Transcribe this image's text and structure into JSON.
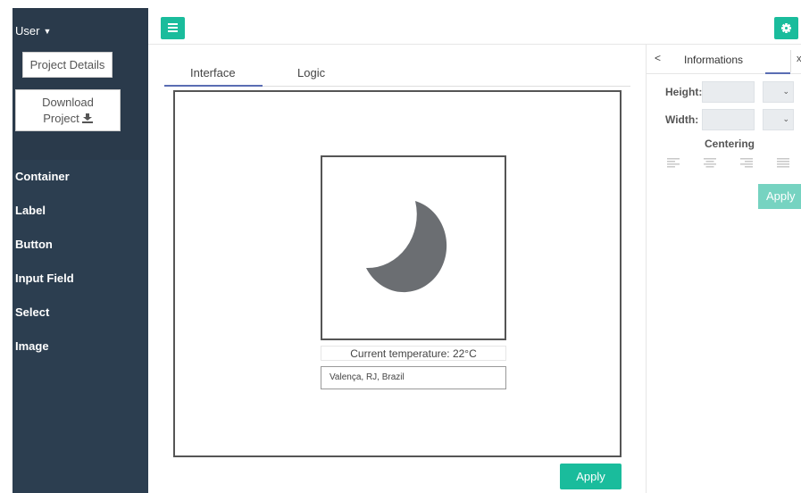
{
  "sidebar": {
    "user_label": "User",
    "project_details_label": "Project Details",
    "download_label_line1": "Download",
    "download_label_line2": "Project",
    "items": [
      {
        "label": "Container"
      },
      {
        "label": "Label"
      },
      {
        "label": "Button"
      },
      {
        "label": "Input Field"
      },
      {
        "label": "Select"
      },
      {
        "label": "Image"
      }
    ]
  },
  "tabs": [
    {
      "label": "Interface",
      "active": true
    },
    {
      "label": "Logic",
      "active": false
    }
  ],
  "canvas": {
    "weather_icon": "crescent-moon-icon",
    "temperature_text": "Current temperature: 22°C",
    "location_value": "Valença, RJ, Brazil"
  },
  "main": {
    "apply_label": "Apply"
  },
  "right_panel": {
    "back_symbol": "<",
    "title": "Informations",
    "close_symbol": "x",
    "height_label": "Height:",
    "width_label": "Width:",
    "centering_label": "Centering",
    "apply_label": "Apply"
  },
  "colors": {
    "sidebar_bg": "#2c3e50",
    "accent": "#1abc9c",
    "tab_underline": "#5a6db3",
    "moon": "#6b6e72"
  }
}
